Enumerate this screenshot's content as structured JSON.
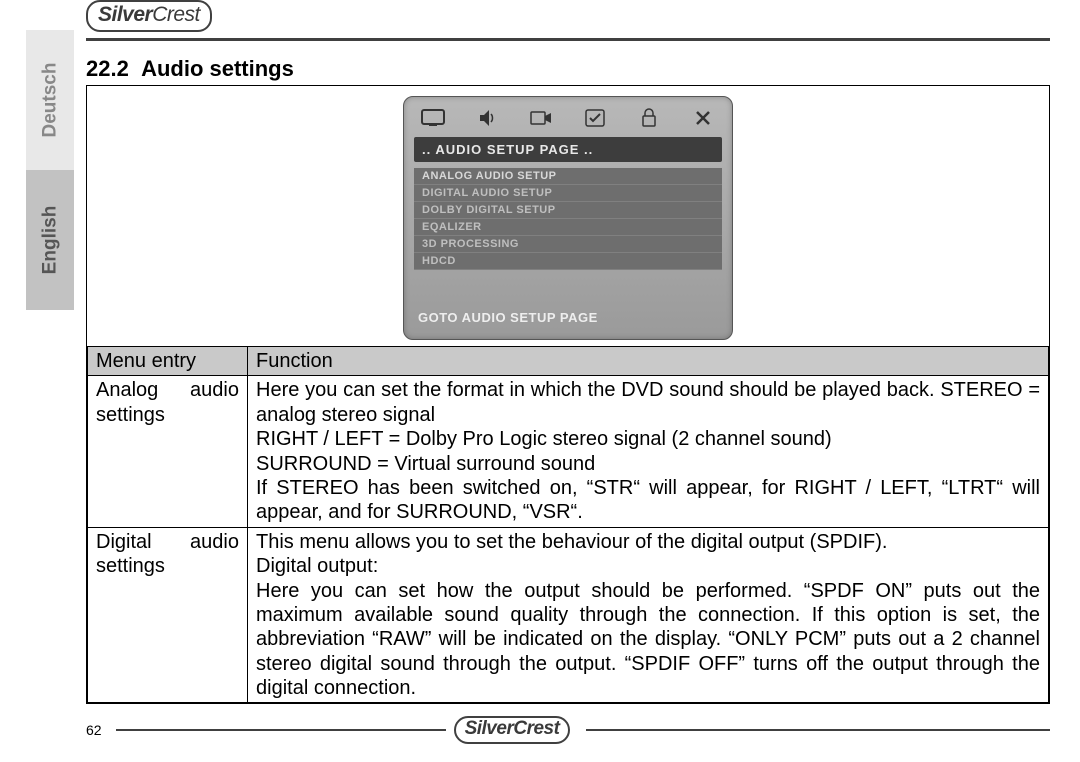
{
  "brand": "SilverCrest",
  "languages": {
    "inactive": "Deutsch",
    "active": "English"
  },
  "section": {
    "number": "22.2",
    "title": "Audio settings"
  },
  "osd": {
    "title": "..  AUDIO SETUP PAGE  ..",
    "items": [
      "ANALOG AUDIO SETUP",
      "DIGITAL AUDIO SETUP",
      "DOLBY DIGITAL SETUP",
      "EQALIZER",
      "3D PROCESSING",
      "HDCD"
    ],
    "footer": "GOTO AUDIO SETUP PAGE",
    "icons": [
      "tv",
      "speaker",
      "note",
      "check",
      "lock",
      "close"
    ]
  },
  "table": {
    "headers": [
      "Menu entry",
      "Function"
    ],
    "rows": [
      {
        "entry": "Analog audio settings",
        "func": "Here you can set the format in which the DVD sound should be played back. STEREO = analog stereo signal\nRIGHT / LEFT = Dolby Pro Logic stereo signal (2 channel sound)\nSURROUND = Virtual surround sound\nIf STEREO has been switched on, “STR“ will appear, for RIGHT / LEFT, “LTRT“ will appear, and for SURROUND, “VSR“."
      },
      {
        "entry": "Digital audio settings",
        "func": "This menu allows you to set the behaviour of the digital output (SPDIF).\nDigital output:\nHere you can set how the output should be performed. “SPDF ON” puts out the maximum available sound quality through the connection. If this option is set, the abbreviation “RAW” will be indicated on the display. “ONLY PCM” puts out a 2 channel stereo digital sound through the output. “SPDIF OFF” turns off the output through the digital connection."
      }
    ]
  },
  "page_number": "62"
}
